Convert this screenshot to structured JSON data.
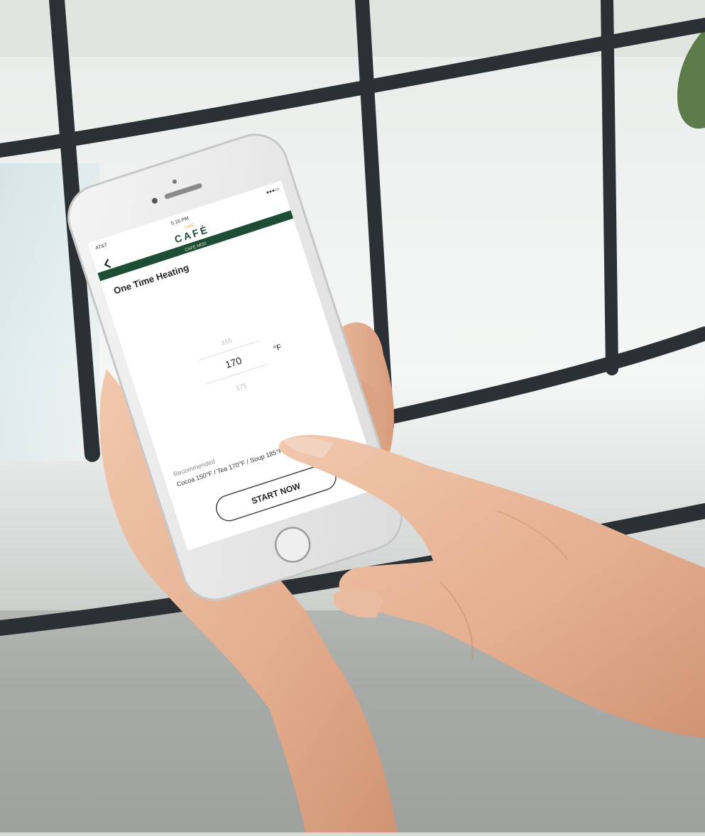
{
  "status_bar": {
    "carrier": "AT&T",
    "time": "5:16 PM",
    "battery": "●●●▭"
  },
  "header": {
    "brand_small": "CAFÉ",
    "brand": "CAFÉ",
    "subtitle": "CAFÉ MOD",
    "back_icon": "chevron-left-icon"
  },
  "screen": {
    "title": "One Time Heating",
    "picker": {
      "above": "165",
      "selected": "170",
      "below": "175",
      "unit": "°F"
    },
    "recommended_label": "Recommended",
    "recommended_values": "Cocoa 150°F / Tea 170°F / Soup 185°F",
    "start_button": "START NOW"
  },
  "colors": {
    "brand_green": "#1e4d35",
    "brand_gold": "#c9a43a",
    "window_frame": "#2a2f33"
  }
}
